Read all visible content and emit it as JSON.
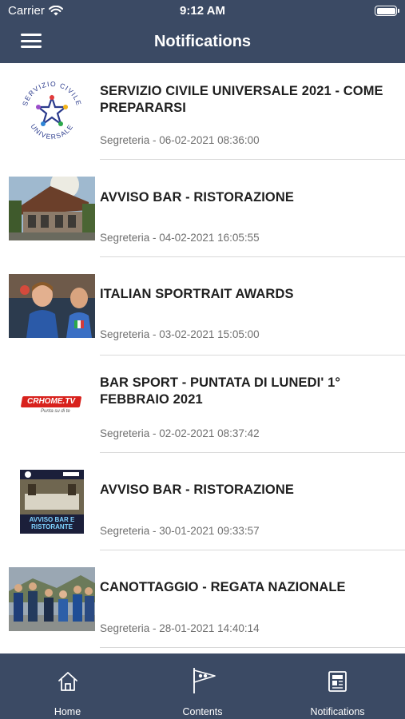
{
  "status": {
    "carrier": "Carrier",
    "time": "9:12 AM"
  },
  "header": {
    "title": "Notifications"
  },
  "items": [
    {
      "title": "SERVIZIO CIVILE UNIVERSALE 2021 - COME PREPARARSI",
      "meta": "Segreteria - 06-02-2021 08:36:00",
      "thumb": "servizio-civile-logo"
    },
    {
      "title": "AVVISO BAR - RISTORAZIONE",
      "meta": "Segreteria - 04-02-2021 16:05:55",
      "thumb": "building-photo"
    },
    {
      "title": "ITALIAN SPORTRAIT AWARDS",
      "meta": "Segreteria - 03-02-2021 15:05:00",
      "thumb": "athletes-photo"
    },
    {
      "title": "BAR SPORT - PUNTATA DI LUNEDI' 1° FEBBRAIO 2021",
      "meta": "Segreteria - 02-02-2021 08:37:42",
      "thumb": "crhome-tv-logo",
      "logo": "CRHOME.TV",
      "logo_tagline": "Punta su di te"
    },
    {
      "title": "AVVISO BAR - RISTORAZIONE",
      "meta": "Segreteria - 30-01-2021 09:33:57",
      "thumb": "bar-poster",
      "poster_text": "AVVISO BAR E RISTORANTE"
    },
    {
      "title": "CANOTTAGGIO - REGATA NAZIONALE",
      "meta": "Segreteria - 28-01-2021 14:40:14",
      "thumb": "rowing-team-photo"
    }
  ],
  "tabs": [
    {
      "label": "Home",
      "icon": "home-icon"
    },
    {
      "label": "Contents",
      "icon": "flag-icon"
    },
    {
      "label": "Notifications",
      "icon": "newspaper-icon"
    }
  ]
}
